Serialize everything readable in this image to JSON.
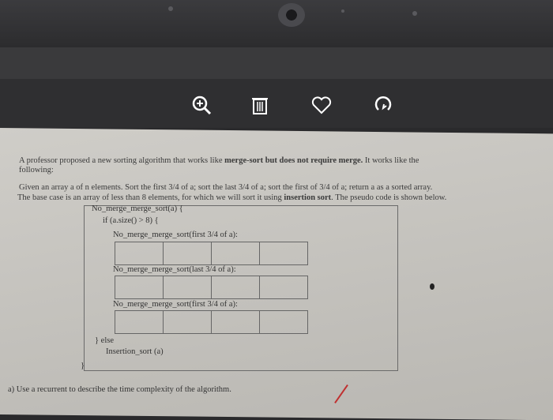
{
  "toolbar": {
    "zoom_icon": "zoom-in-icon",
    "delete_icon": "trash-icon",
    "like_icon": "heart-icon",
    "rotate_icon": "rotate-icon"
  },
  "document": {
    "line1": "A professor proposed a new sorting algorithm that works like",
    "line1_bold": "merge-sort but does not require merge.",
    "line1_end": "It works like the",
    "line1b": "following:",
    "line2": "Given an array a of n elements. Sort the first 3/4 of a; sort the last 3/4 of a; sort the first of 3/4 of a; return a as a sorted array.",
    "line3_start": "The base case is an array of less than 8 elements, for which we will sort it using",
    "line3_bold": "insertion sort",
    "line3_end": ". The pseudo code is shown below.",
    "code": {
      "fn": "No_merge_merge_sort(a) {",
      "if": "if (a.size() > 8) {",
      "call1": "No_merge_merge_sort(first 3/4 of a):",
      "call2": "No_merge_merge_sort(last 3/4 of a):",
      "call3": "No_merge_merge_sort(first 3/4 of a):",
      "else": "} else",
      "ins": "Insertion_sort (a)",
      "close": "}"
    },
    "question": "a)  Use a recurrent to describe the time complexity of the algorithm."
  }
}
